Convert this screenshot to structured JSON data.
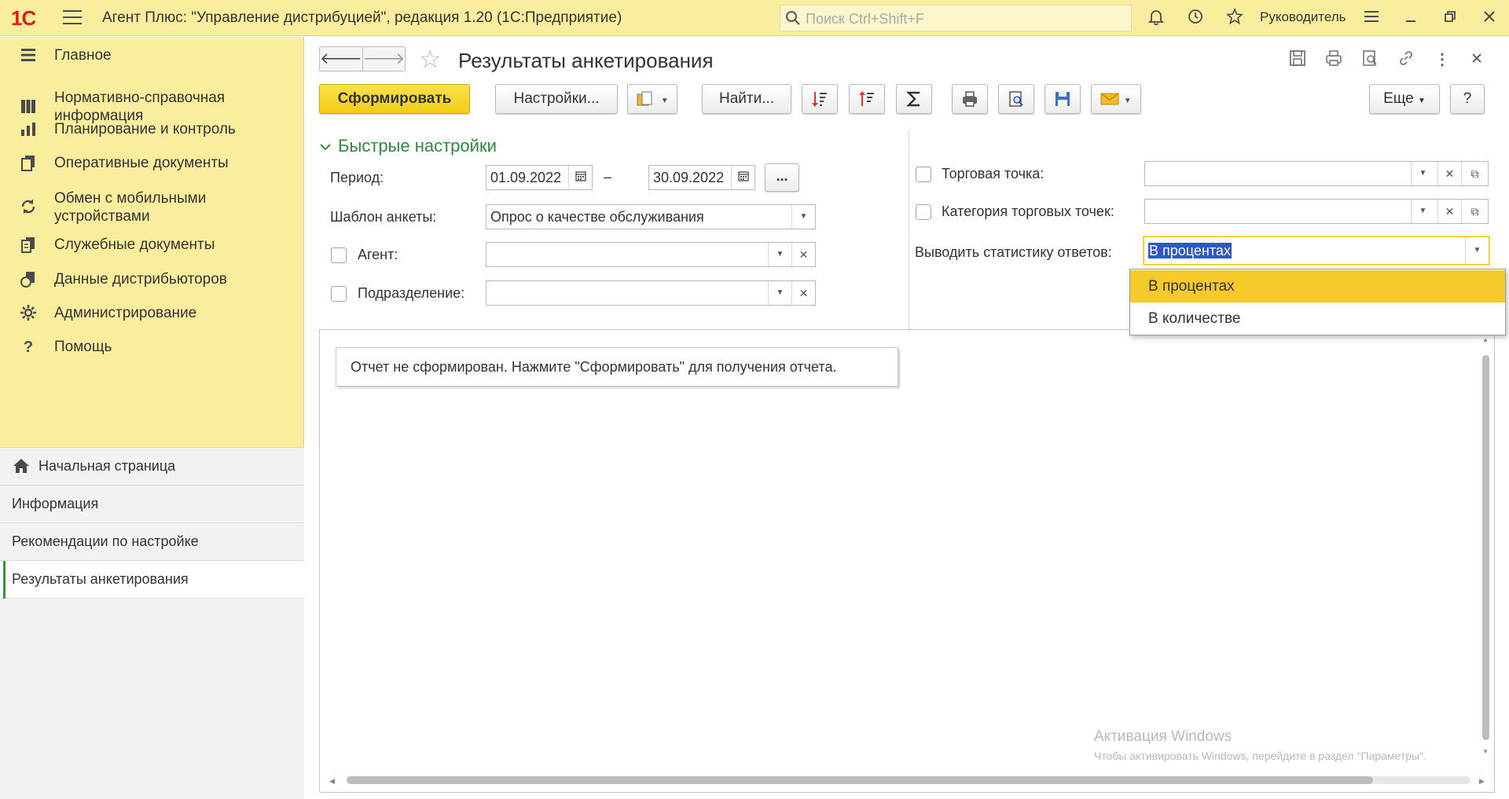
{
  "window": {
    "title": "Агент Плюс: \"Управление дистрибуцией\", редакция 1.20  (1С:Предприятие)",
    "logo": "1С",
    "search_placeholder": "Поиск Ctrl+Shift+F",
    "user": "Руководитель"
  },
  "sidebar": {
    "items": [
      {
        "label": "Главное",
        "icon": "list-icon"
      },
      {
        "label": "Нормативно-справочная\nинформация",
        "icon": "catalog-icon"
      },
      {
        "label": "Планирование и контроль",
        "icon": "chart-icon"
      },
      {
        "label": "Оперативные документы",
        "icon": "documents-icon"
      },
      {
        "label": "Обмен с мобильными\nустройствами",
        "icon": "sync-icon"
      },
      {
        "label": "Служебные документы",
        "icon": "service-docs-icon"
      },
      {
        "label": "Данные дистрибьюторов",
        "icon": "distributors-icon"
      },
      {
        "label": "Администрирование",
        "icon": "gear-icon"
      },
      {
        "label": "Помощь",
        "icon": "help-icon"
      }
    ],
    "open_windows": [
      {
        "label": "Начальная страница",
        "icon": "home-icon"
      },
      {
        "label": "Информация"
      },
      {
        "label": "Рекомендации по настройке"
      },
      {
        "label": "Результаты анкетирования",
        "active": true
      }
    ]
  },
  "form": {
    "title": "Результаты анкетирования",
    "toolbar": {
      "generate": "Сформировать",
      "settings": "Настройки...",
      "find": "Найти...",
      "more": "Еще",
      "help": "?"
    },
    "quick_settings": "Быстрые настройки",
    "period_label": "Период:",
    "period_from": "01.09.2022",
    "period_dash": "–",
    "period_to": "30.09.2022",
    "period_more": "...",
    "template_label": "Шаблон анкеты:",
    "template_value": "Опрос о качестве обслуживания",
    "agent_label": "Агент:",
    "division_label": "Подразделение:",
    "outlet_label": "Торговая точка:",
    "outlet_category_label": "Категория торговых точек:",
    "stats_label": "Выводить статистику ответов:",
    "stats_value": "В процентах",
    "stats_options": [
      "В процентах",
      "В количестве"
    ],
    "report_message": "Отчет не сформирован. Нажмите \"Сформировать\" для получения отчета."
  },
  "watermark": {
    "line1": "Активация Windows",
    "line2": "Чтобы активировать Windows, перейдите в раздел \"Параметры\"."
  },
  "colors": {
    "panel": "#fbed9e",
    "accent_green": "#2d8a3a",
    "primary_button": "#f1cc15",
    "selection": "#2e57c8"
  }
}
